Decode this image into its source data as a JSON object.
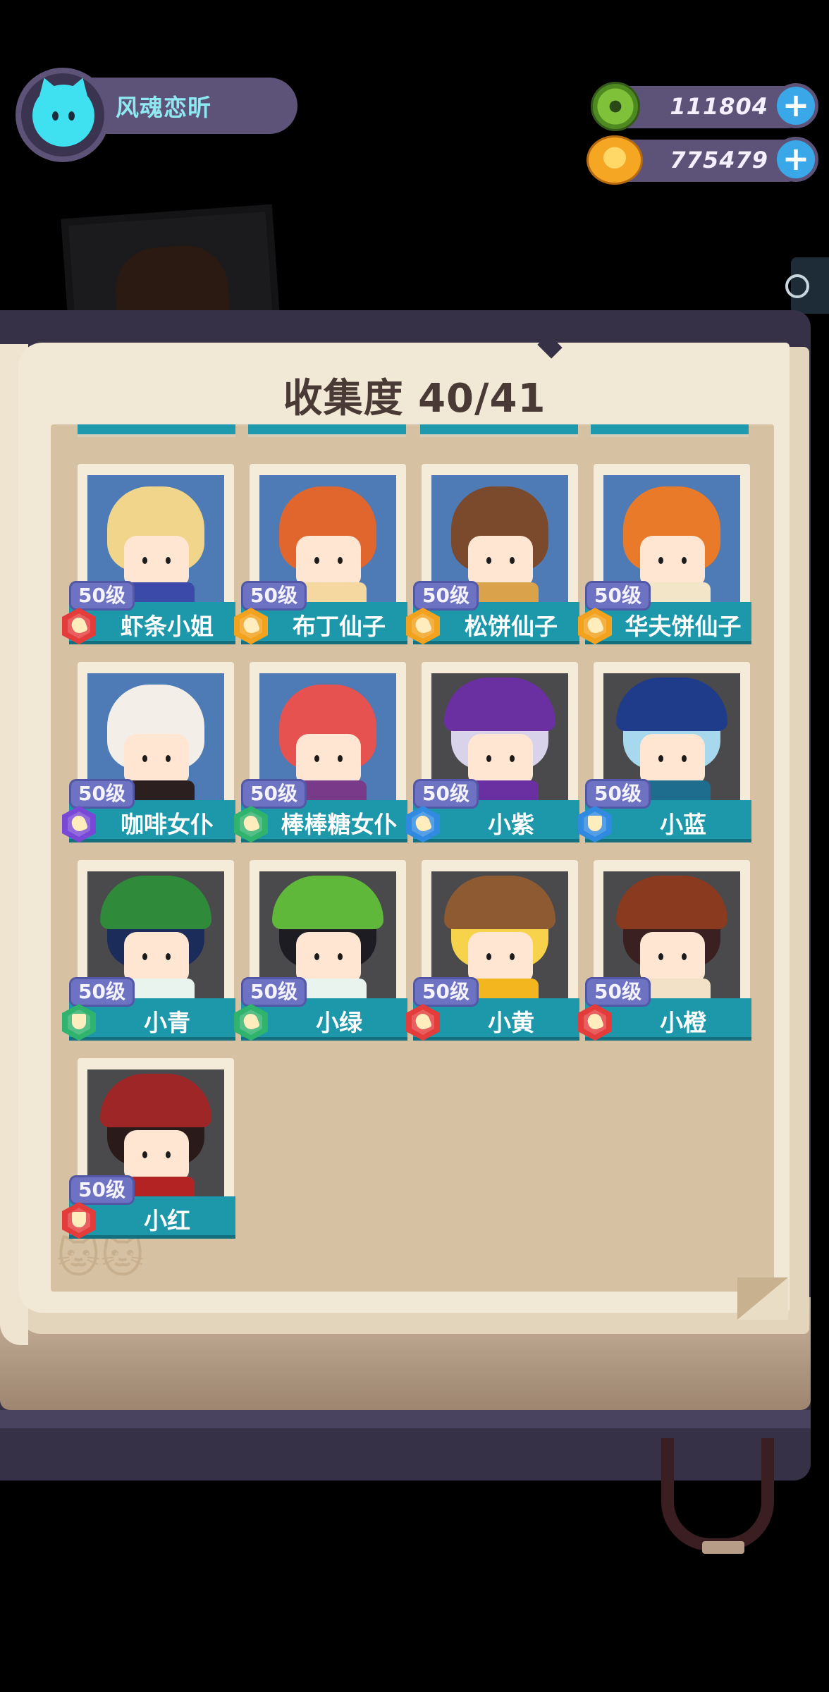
{
  "player": {
    "name": "风魂恋昕"
  },
  "currencies": [
    {
      "icon": "green-gem-coin-icon",
      "value": "111804"
    },
    {
      "icon": "gold-planet-coin-icon",
      "value": "775479"
    }
  ],
  "collection": {
    "title": "收集度 40/41"
  },
  "colors": {
    "red": "#e43b3b",
    "orange": "#f2a21d",
    "purple": "#7a48d6",
    "green": "#2fb36d",
    "blue": "#2f8ae0"
  },
  "characters": [
    {
      "name": "虾条小姐",
      "level": "50级",
      "role": "attack",
      "color": "red",
      "unlocked": true,
      "hair": "#f0d58a",
      "outfit": "#3b4aa8"
    },
    {
      "name": "布丁仙子",
      "level": "50级",
      "role": "attack",
      "color": "orange",
      "unlocked": true,
      "hair": "#e0662e",
      "outfit": "#f5d8a0"
    },
    {
      "name": "松饼仙子",
      "level": "50级",
      "role": "attack",
      "color": "orange",
      "unlocked": true,
      "hair": "#7b4a2c",
      "outfit": "#d9a24b"
    },
    {
      "name": "华夫饼仙子",
      "level": "50级",
      "role": "attack",
      "color": "orange",
      "unlocked": true,
      "hair": "#e87a2a",
      "outfit": "#f3e5c8"
    },
    {
      "name": "咖啡女仆",
      "level": "50级",
      "role": "attack",
      "color": "purple",
      "unlocked": true,
      "hair": "#f3efe8",
      "outfit": "#2b1f1f"
    },
    {
      "name": "棒棒糖女仆",
      "level": "50级",
      "role": "attack",
      "color": "green",
      "unlocked": true,
      "hair": "#e5524f",
      "outfit": "#7a3a8a"
    },
    {
      "name": "小紫",
      "level": "50级",
      "role": "attack",
      "color": "blue",
      "unlocked": false,
      "hair": "#d8d2ea",
      "hat": "#6a2fa0",
      "outfit": "#6a2fa0"
    },
    {
      "name": "小蓝",
      "level": "50级",
      "role": "shield",
      "color": "blue",
      "unlocked": false,
      "hair": "#a8d8ee",
      "hat": "#1f3c8a",
      "outfit": "#1e6d8e"
    },
    {
      "name": "小青",
      "level": "50级",
      "role": "shield",
      "color": "green",
      "unlocked": false,
      "hair": "#1b2b5a",
      "hat": "#2f8a3a",
      "outfit": "#e9f4ee"
    },
    {
      "name": "小绿",
      "level": "50级",
      "role": "attack",
      "color": "green",
      "unlocked": false,
      "hair": "#1c1c22",
      "hat": "#5fb83a",
      "outfit": "#e9f4ee"
    },
    {
      "name": "小黄",
      "level": "50级",
      "role": "attack",
      "color": "red",
      "unlocked": false,
      "hair": "#f6d34a",
      "hat": "#8e5a32",
      "outfit": "#f3b61f"
    },
    {
      "name": "小橙",
      "level": "50级",
      "role": "attack",
      "color": "red",
      "unlocked": false,
      "hair": "#3a2020",
      "hat": "#8a3a1f",
      "outfit": "#f2e1c6"
    },
    {
      "name": "小红",
      "level": "50级",
      "role": "shield",
      "color": "red",
      "unlocked": false,
      "hair": "#2a1a1a",
      "hat": "#9e2626",
      "outfit": "#b42323"
    }
  ]
}
